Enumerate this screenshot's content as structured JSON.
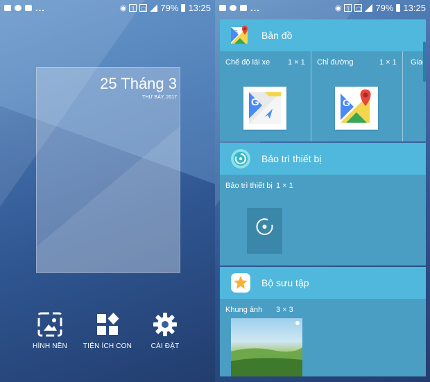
{
  "status_bar": {
    "battery": "79%",
    "time": "13:25",
    "dots": "..."
  },
  "home": {
    "clock_date": "25 Tháng 3",
    "clock_weekday": "THỨ BẢY, 2017",
    "tray": [
      {
        "label": "HÌNH NỀN",
        "icon": "wallpaper-icon"
      },
      {
        "label": "TIỆN ÍCH CON",
        "icon": "widgets-icon"
      },
      {
        "label": "CÀI ĐẶT",
        "icon": "settings-gear-icon"
      }
    ]
  },
  "widget_list": {
    "apps": [
      {
        "name": "Bản đồ",
        "icon": "google-maps-icon",
        "widgets": [
          {
            "name": "Chế độ lái xe",
            "size": "1 × 1",
            "icon": "maps-driving-icon"
          },
          {
            "name": "Chỉ đường",
            "size": "1 × 1",
            "icon": "maps-directions-icon"
          },
          {
            "name": "Giao",
            "size": "",
            "icon": ""
          }
        ]
      },
      {
        "name": "Bảo trì thiết bị",
        "icon": "device-maintenance-icon",
        "widgets": [
          {
            "name": "Bảo trì thiết bị",
            "size": "1 × 1",
            "icon": "device-maintenance-widget-icon"
          }
        ]
      },
      {
        "name": "Bộ sưu tập",
        "icon": "gallery-icon",
        "widgets": [
          {
            "name": "Khung ảnh",
            "size": "3 × 3",
            "icon": "photo-frame-preview"
          }
        ]
      }
    ]
  },
  "colors": {
    "app_header": "#4fb8dc",
    "widget_body": "#4a9ec4",
    "wallpaper_dark": "#223d6e"
  }
}
